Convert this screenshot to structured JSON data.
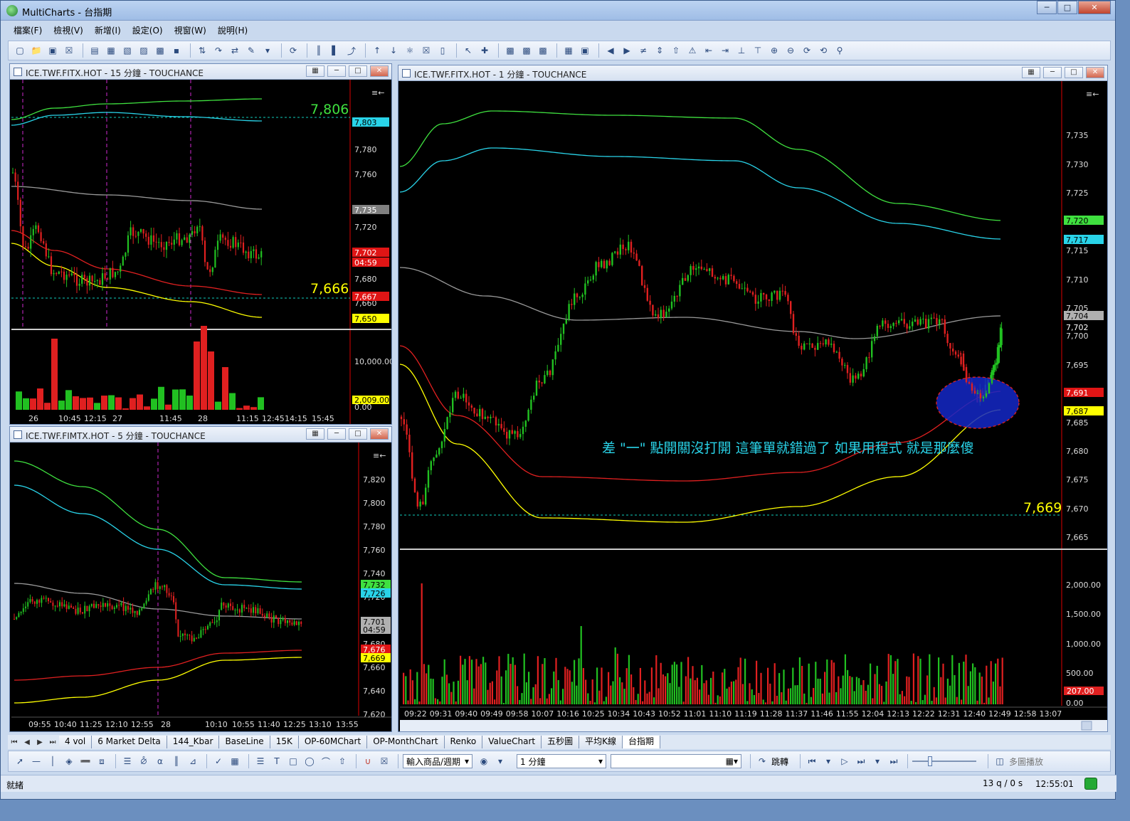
{
  "app": {
    "title": "MultiCharts - 台指期"
  },
  "menu": [
    "檔案(F)",
    "檢視(V)",
    "新增(I)",
    "設定(O)",
    "視窗(W)",
    "說明(H)"
  ],
  "win1": {
    "title": "ICE.TWF.FITX.HOT - 15 分鐘 - TOUCHANCE",
    "marker_high": "7,806",
    "marker_low": "7,666",
    "prices": [
      "7,780",
      "7,760",
      "7,720",
      "7,680",
      "7,660"
    ],
    "badges": [
      {
        "text": "7,803",
        "color": "#29d3e8"
      },
      {
        "text": "7,735",
        "color": "#808080"
      },
      {
        "text": "7,702",
        "color": "#e01515"
      },
      {
        "text": "04:59",
        "color": "#e01515"
      },
      {
        "text": "7,667",
        "color": "#e01515"
      },
      {
        "text": "7,650",
        "color": "#ffff00"
      }
    ],
    "vol_labels": [
      "10,000.00",
      "0.00"
    ],
    "vol_badge": "2,009.00",
    "xlabels": [
      "26",
      "10:45",
      "12:15",
      "27",
      "11:45",
      "28",
      "11:15",
      "12:45",
      "14:15",
      "15:45"
    ]
  },
  "win2": {
    "title": "ICE.TWF.FIMTX.HOT - 5 分鐘 - TOUCHANCE",
    "prices": [
      "7,820",
      "7,800",
      "7,780",
      "7,760",
      "7,740",
      "7,720",
      "7,680",
      "7,660",
      "7,640",
      "7,620"
    ],
    "badges": [
      {
        "text": "7,732",
        "color": "#3fe03f"
      },
      {
        "text": "7,726",
        "color": "#29d3e8"
      },
      {
        "text": "7,701",
        "color": "#b0b0b0"
      },
      {
        "text": "04:59",
        "color": "#b0b0b0"
      },
      {
        "text": "7,676",
        "color": "#e01515"
      },
      {
        "text": "7,669",
        "color": "#ffff00"
      }
    ],
    "xlabels": [
      "09:55",
      "10:40",
      "11:25",
      "12:10",
      "12:55",
      "28",
      "10:10",
      "10:55",
      "11:40",
      "12:25",
      "13:10",
      "13:55"
    ]
  },
  "win3": {
    "title": "ICE.TWF.FITX.HOT - 1 分鐘 - TOUCHANCE",
    "prices": [
      "7,735",
      "7,730",
      "7,725",
      "7,715",
      "7,710",
      "7,705",
      "7,700",
      "7,695",
      "7,690",
      "7,685",
      "7,680",
      "7,675",
      "7,670",
      "7,665"
    ],
    "badges": [
      {
        "text": "7,720",
        "color": "#3fe03f"
      },
      {
        "text": "7,717",
        "color": "#29d3e8"
      },
      {
        "text": "7,704",
        "color": "#b0b0b0"
      },
      {
        "text": "7,702",
        "color": "#000000"
      },
      {
        "text": "7,691",
        "color": "#e01515"
      },
      {
        "text": "7,687",
        "color": "#ffff00"
      }
    ],
    "marker_low": "7,669",
    "annotation": "差 \"一\" 點開關沒打開 這筆單就錯過了 如果用程式 就是那麼傻",
    "vol_labels": [
      "2,000.00",
      "1,500.00",
      "1,000.00",
      "500.00",
      "0.00"
    ],
    "vol_badge": "207.00",
    "xlabels": [
      "09:22",
      "09:31",
      "09:40",
      "09:49",
      "09:58",
      "10:07",
      "10:16",
      "10:25",
      "10:34",
      "10:43",
      "10:52",
      "11:01",
      "11:10",
      "11:19",
      "11:28",
      "11:37",
      "11:46",
      "11:55",
      "12:04",
      "12:13",
      "12:22",
      "12:31",
      "12:40",
      "12:49",
      "12:58",
      "13:07"
    ]
  },
  "tabs": [
    "4 vol",
    "6 Market Delta",
    "144_Kbar",
    "BaseLine",
    "15K",
    "OP-60MChart",
    "OP-MonthChart",
    "Renko",
    "ValueChart",
    "五秒圖",
    "平均K線",
    "台指期"
  ],
  "active_tab": "台指期",
  "drawbar": {
    "symbol_select": "輸入商品/週期",
    "interval_select": "1 分鐘",
    "jump_label": "跳轉",
    "playback_label": "多圖播放"
  },
  "status": {
    "left": "就緒",
    "queue": "13 q / 0 s",
    "time": "12:55:01"
  }
}
